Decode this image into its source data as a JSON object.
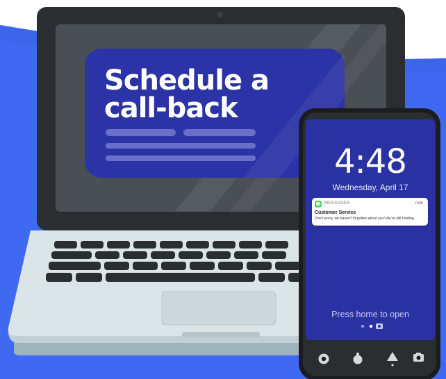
{
  "laptop": {
    "screen_headline_line1": "Schedule a",
    "screen_headline_line2": "call-back"
  },
  "phone": {
    "time": "4:48",
    "date": "Wednesday, April 17",
    "notification": {
      "app": "MESSAGES",
      "time": "now",
      "title": "Customer Service",
      "body": "Don't worry, we haven't forgotten about you! We're still holding"
    },
    "unlock_hint": "Press home to open",
    "nav_icons": [
      "record-icon",
      "assistant-icon",
      "home-icon",
      "camera-icon"
    ]
  },
  "colors": {
    "background_blue": "#3f69f0",
    "laptop_frame": "#2b2e31",
    "laptop_screen": "#4a4f55",
    "screen_card": "#2c33a6",
    "laptop_body": "#dbe4e6",
    "phone_screen": "#2a31a3"
  }
}
